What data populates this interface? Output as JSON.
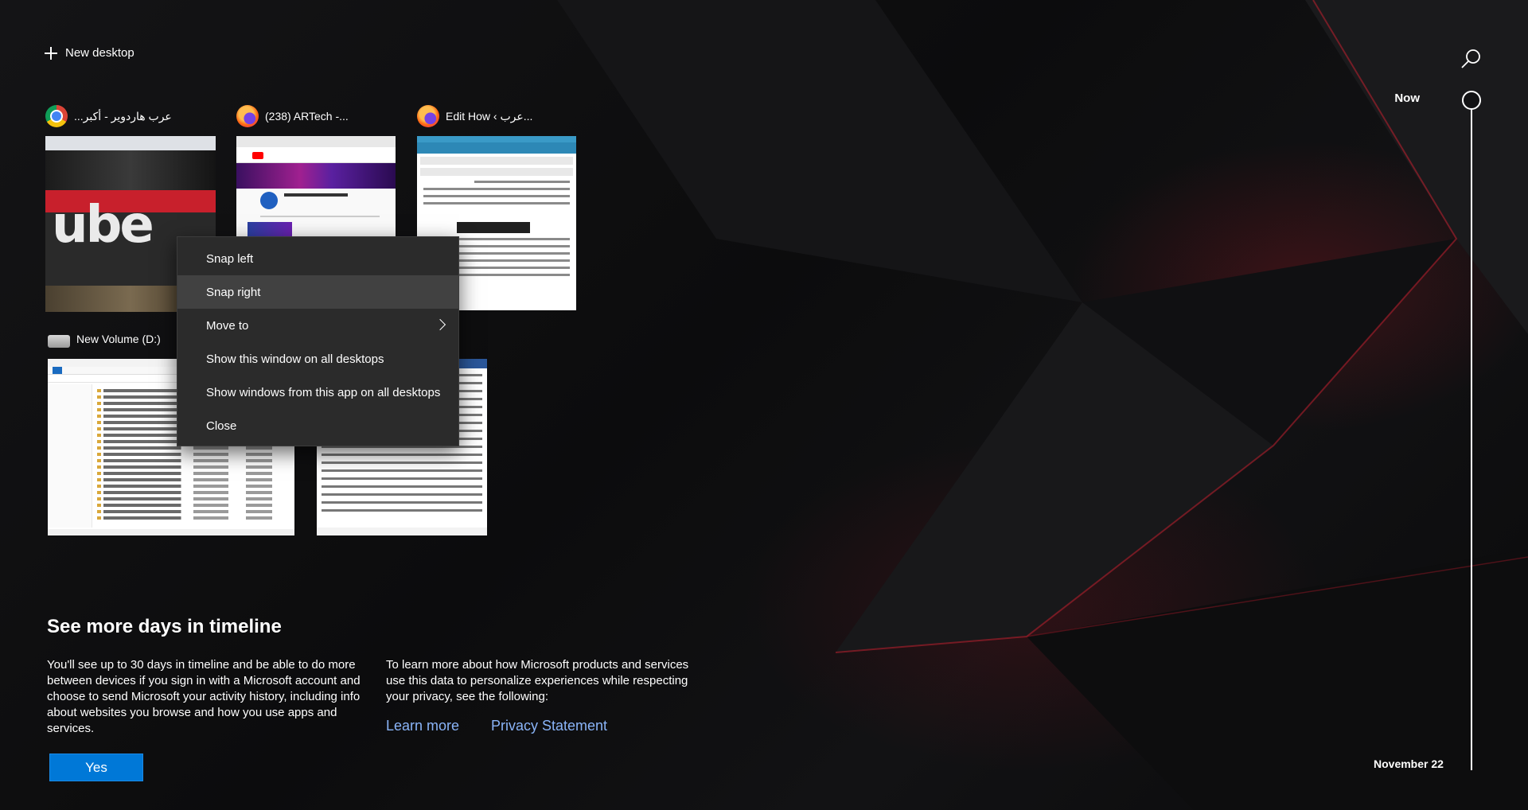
{
  "header": {
    "new_desktop_label": "New desktop",
    "search_icon": "search-icon"
  },
  "timeline": {
    "now_label": "Now",
    "date_label": "November 22"
  },
  "windows": [
    {
      "app": "chrome",
      "icon": "chrome-icon",
      "title": "عرب هاردوير - أكبر..."
    },
    {
      "app": "firefox",
      "icon": "firefox-icon",
      "title": "(238) ARTech -..."
    },
    {
      "app": "firefox",
      "icon": "firefox-icon",
      "title": "Edit How ‹ عرب..."
    },
    {
      "app": "file-explorer",
      "icon": "drive-icon",
      "title": "New Volume (D:)"
    },
    {
      "app": "word",
      "icon": "word-icon",
      "title": ""
    }
  ],
  "thumbs": {
    "uber_text": "ube"
  },
  "context_menu": {
    "items": [
      {
        "label": "Snap left"
      },
      {
        "label": "Snap right"
      },
      {
        "label": "Move to",
        "submenu": true
      },
      {
        "label": "Show this window on all desktops"
      },
      {
        "label": "Show windows from this app on all desktops"
      },
      {
        "label": "Close"
      }
    ],
    "highlighted": "Snap right"
  },
  "promo": {
    "title": "See more days in timeline",
    "left_text": "You'll see up to 30 days in timeline and be able to do more between devices if you sign in with a Microsoft account and choose to send Microsoft your activity history, including info about websites you browse and how you use apps and services.",
    "right_text": "To learn more about how Microsoft products and services use this data to personalize experiences while respecting your privacy, see the following:",
    "learn_more": "Learn more",
    "privacy_statement": "Privacy Statement",
    "yes_button": "Yes"
  },
  "colors": {
    "accent": "#0078d7",
    "link": "#8ab4f8",
    "menu_bg": "#2b2b2b",
    "menu_hover": "#414141"
  }
}
